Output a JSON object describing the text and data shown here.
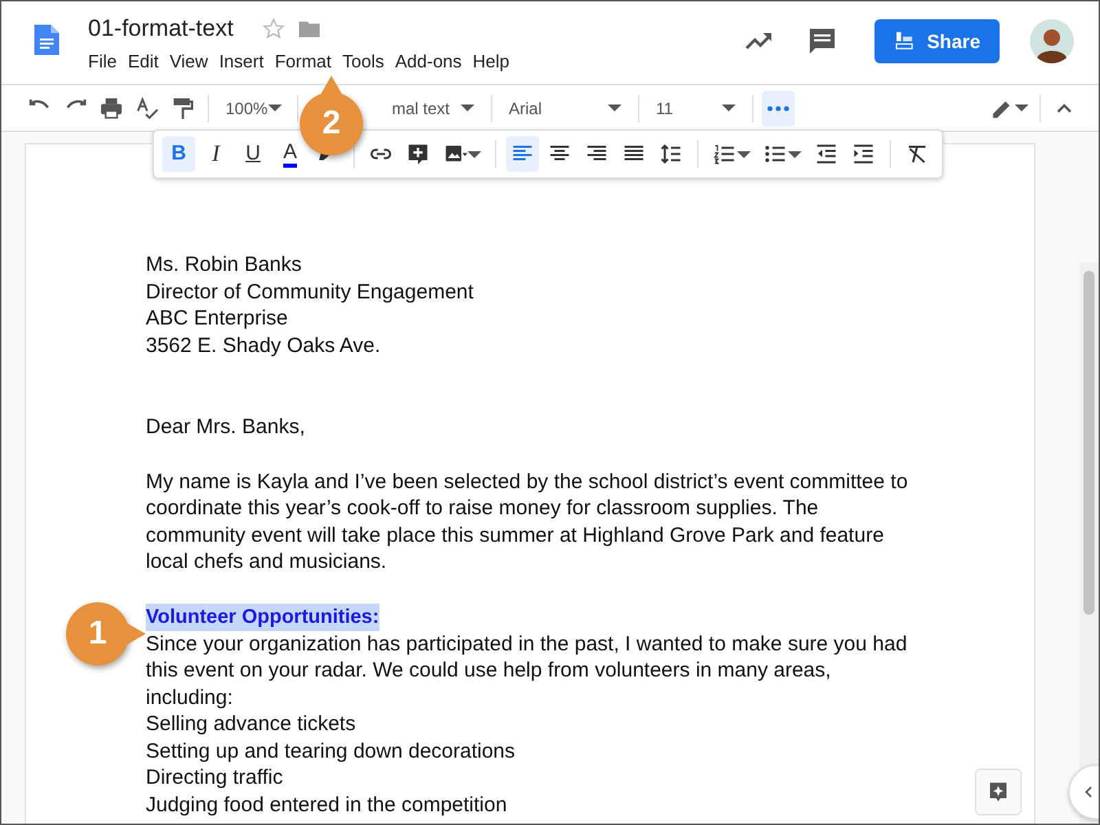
{
  "app": {
    "title": "01-format-text",
    "menu": [
      "File",
      "Edit",
      "View",
      "Insert",
      "Format",
      "Tools",
      "Add-ons",
      "Help"
    ],
    "share_button": "Share"
  },
  "toolbar": {
    "zoom": "100%",
    "style": "mal text",
    "font": "Arial",
    "size": "11",
    "more_selected": true
  },
  "format_toolbar": [
    {
      "kind": "bold",
      "label": "B",
      "selected": true
    },
    {
      "kind": "italic",
      "label": "I",
      "selected": false
    },
    {
      "kind": "underline",
      "label": "U",
      "selected": false
    },
    {
      "kind": "text-color",
      "label": "A",
      "selected": false
    },
    {
      "kind": "highlight",
      "selected": false
    },
    {
      "kind": "sep"
    },
    {
      "kind": "link",
      "selected": false
    },
    {
      "kind": "comment",
      "selected": false
    },
    {
      "kind": "image",
      "selected": false
    },
    {
      "kind": "sep"
    },
    {
      "kind": "align-left",
      "selected": true
    },
    {
      "kind": "align-center",
      "selected": false
    },
    {
      "kind": "align-right",
      "selected": false
    },
    {
      "kind": "justify",
      "selected": false
    },
    {
      "kind": "line-spacing",
      "selected": false
    },
    {
      "kind": "sep"
    },
    {
      "kind": "numbered-list",
      "selected": false
    },
    {
      "kind": "bulleted-list",
      "selected": false
    },
    {
      "kind": "indent-less",
      "selected": false
    },
    {
      "kind": "indent-more",
      "selected": false
    },
    {
      "kind": "sep"
    },
    {
      "kind": "clear-format",
      "selected": false
    }
  ],
  "document": {
    "address": [
      "Ms. Robin Banks",
      "Director of Community Engagement",
      "ABC Enterprise",
      "3562 E. Shady Oaks Ave."
    ],
    "greeting": "Dear Mrs. Banks,",
    "paragraph": "My name is Kayla and I’ve been selected by the school district’s event committee to coordinate this year’s cook-off to raise money for classroom supplies. The community event will take place this summer at Highland Grove Park and feature local chefs and musicians.",
    "heading": "Volunteer Opportunities:",
    "heading_selected": true,
    "body": "Since your organization has participated in the past, I wanted to make sure you had this event on your radar. We could use help from volunteers in many areas, including:",
    "list": [
      "Selling advance tickets",
      "Setting up and tearing down decorations",
      "Directing traffic",
      "Judging food entered in the competition"
    ]
  },
  "callouts": [
    {
      "number": "1"
    },
    {
      "number": "2"
    }
  ]
}
